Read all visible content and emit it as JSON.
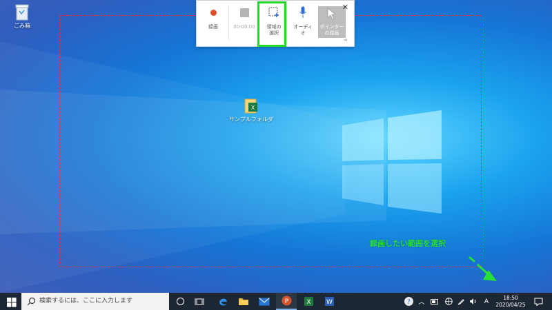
{
  "desktop": {
    "recycle_bin_label": "ごみ箱",
    "folder_label": "サンプルフォルダ"
  },
  "toolbar": {
    "record_label": "録画",
    "timer": "00:00:00",
    "select_area_line1": "領域の",
    "select_area_line2": "選択",
    "audio_line1": "オーディ",
    "audio_line2": "オ",
    "pointer_line1": "ポインター",
    "pointer_line2": "の録画",
    "close_glyph": "✕",
    "pin_glyph": "⊸"
  },
  "annotation": {
    "text": "録画したい範囲を選択",
    "color": "#22d82a"
  },
  "taskbar": {
    "search_placeholder": "検索するには、ここに入力します",
    "ime_indicator": "A",
    "time": "18:50",
    "date": "2020/04/25"
  },
  "colors": {
    "selection_border": "#e8323c",
    "highlight": "#22d82a",
    "record_dot": "#e0502a",
    "taskbar": "#1c2733"
  }
}
